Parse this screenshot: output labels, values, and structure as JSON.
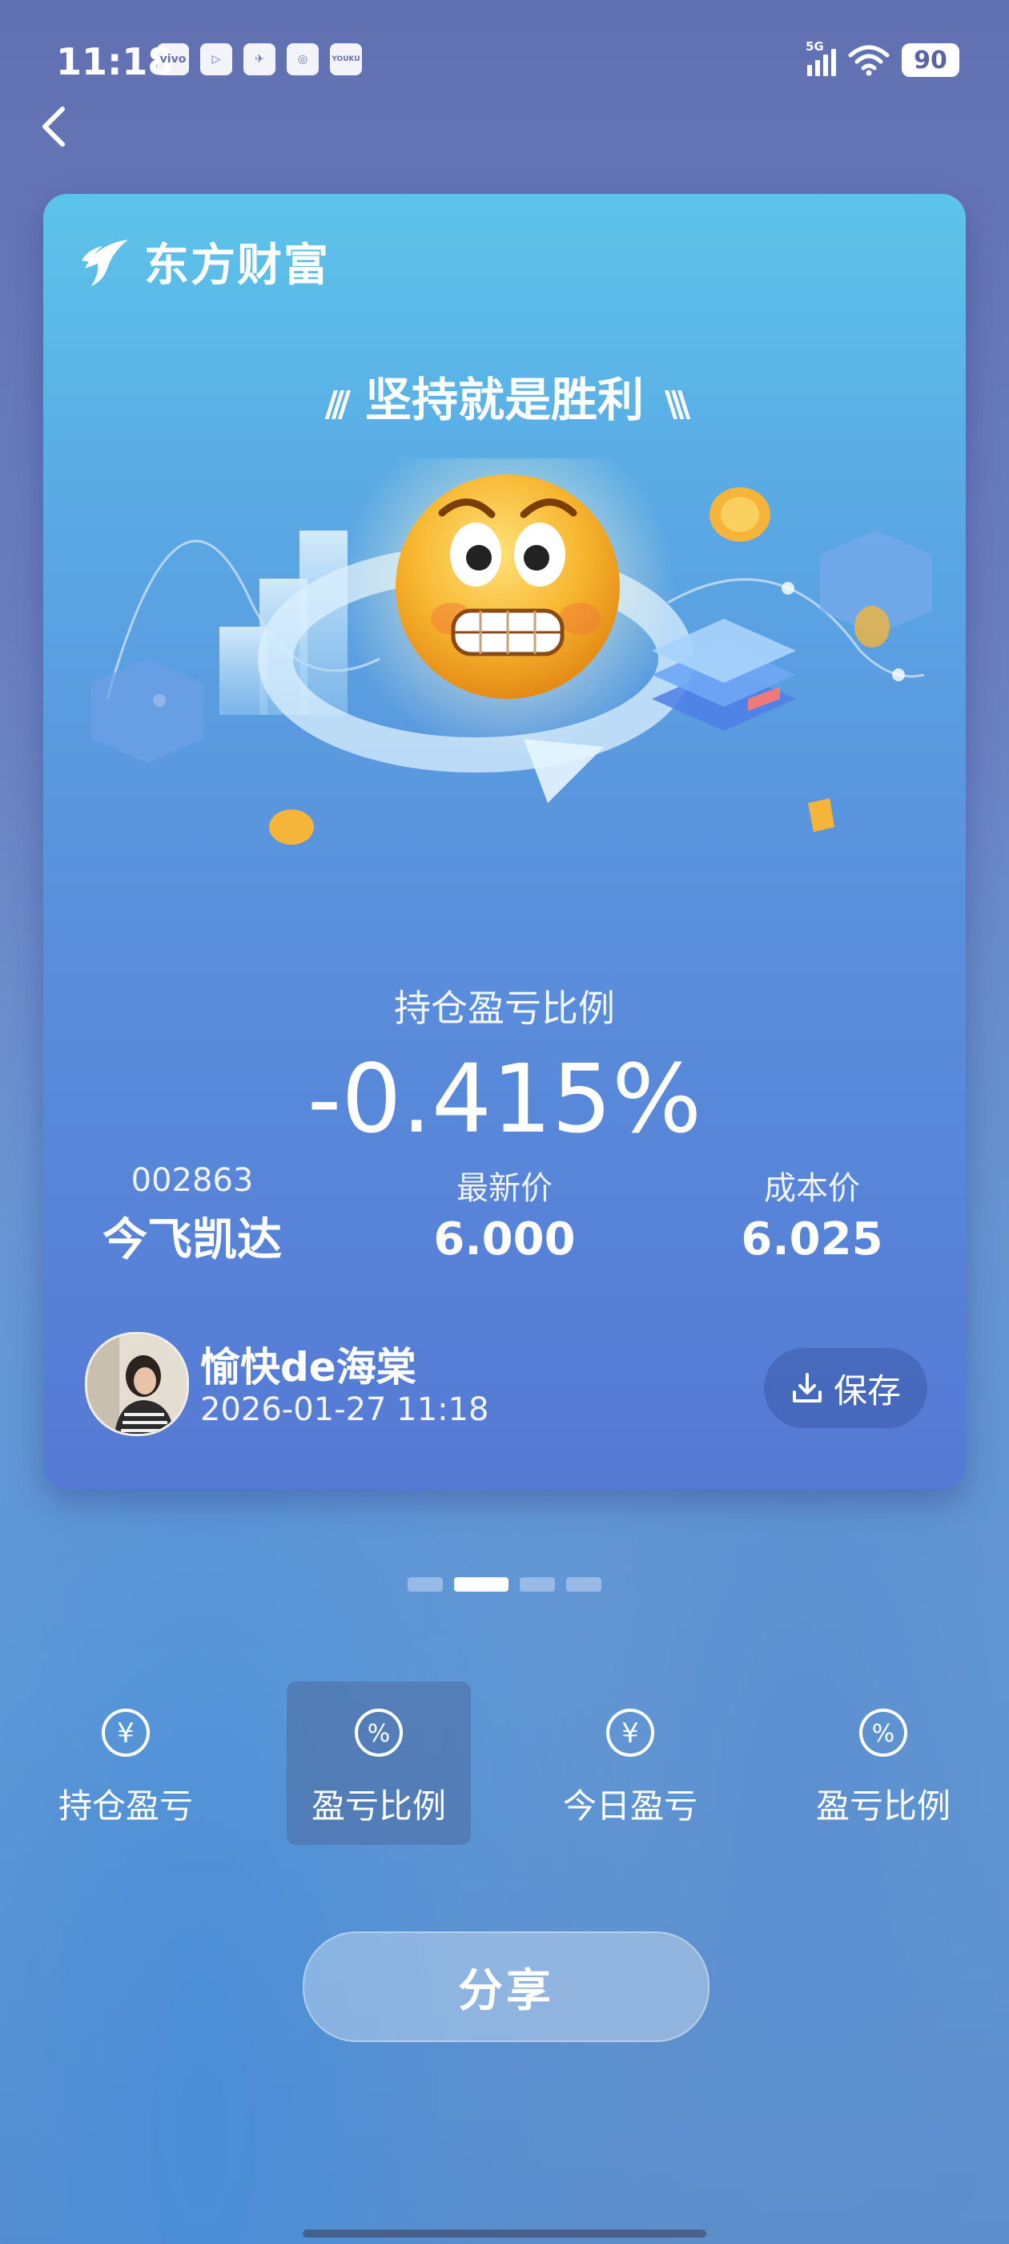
{
  "status_bar": {
    "time": "11:18",
    "apps": [
      "vivo",
      "▷",
      "✈",
      "◎",
      "YOUKU"
    ],
    "network": "5G",
    "battery": "90"
  },
  "card": {
    "brand": "东方财富",
    "motto": "坚持就是胜利",
    "ratio_label": "持仓盈亏比例",
    "ratio_value": "-0.415%",
    "stock": {
      "code": "002863",
      "name": "今飞凯达"
    },
    "latest_price": {
      "label": "最新价",
      "value": "6.000"
    },
    "cost_price": {
      "label": "成本价",
      "value": "6.025"
    },
    "user": {
      "name": "愉快de海棠",
      "datetime": "2026-01-27 11:18"
    },
    "save_label": "保存"
  },
  "pagination": {
    "count": 4,
    "active_index": 1
  },
  "options": [
    {
      "label": "持仓盈亏",
      "icon": "yen-icon",
      "active": false
    },
    {
      "label": "盈亏比例",
      "icon": "percent-icon",
      "active": true
    },
    {
      "label": "今日盈亏",
      "icon": "yen-icon",
      "active": false
    },
    {
      "label": "盈亏比例",
      "icon": "percent-icon",
      "active": false
    }
  ],
  "share_label": "分享",
  "colors": {
    "card_top": "#5cc4ea",
    "card_bottom": "#5579d4",
    "accent_coin": "#f4b53a"
  }
}
